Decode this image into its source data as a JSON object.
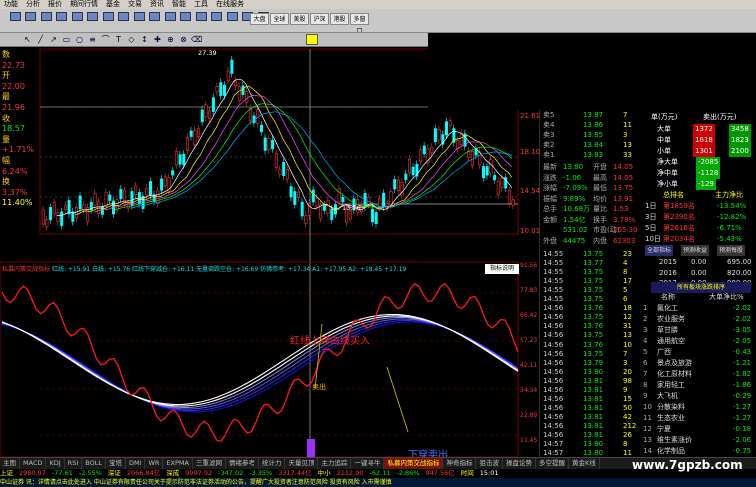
{
  "menu": [
    "功能",
    "分析",
    "报价",
    "期间行情",
    "基金",
    "交易",
    "资讯",
    "智能",
    "工具",
    "在线服务"
  ],
  "toolbar": [
    {
      "label": "退出",
      "icon": "back-icon"
    },
    {
      "label": "自选",
      "icon": "star-icon"
    },
    {
      "label": "大盘",
      "icon": "index-icon"
    },
    {
      "label": "行情",
      "icon": "quote-icon"
    },
    {
      "label": "分时",
      "icon": "minute-icon"
    },
    {
      "label": "K线",
      "icon": "kline-icon"
    },
    {
      "label": "个股",
      "icon": "stock-icon"
    },
    {
      "label": "板块",
      "icon": "sector-icon"
    },
    {
      "label": "资讯",
      "icon": "news-icon"
    },
    {
      "label": "委托",
      "icon": "trade-icon"
    },
    {
      "label": "F10",
      "icon": "f10-icon"
    },
    {
      "label": "全景",
      "icon": "view-icon"
    },
    {
      "label": "日线",
      "icon": "day-icon"
    },
    {
      "label": "周线",
      "icon": "week-icon"
    },
    {
      "label": "月线",
      "icon": "month-icon"
    },
    {
      "label": "预警",
      "icon": "alert-icon"
    },
    {
      "label": "条件",
      "icon": "filter-icon"
    }
  ],
  "toolbar_right": [
    "大盘",
    "全球",
    "美股",
    "沪深",
    "港股",
    "多窗口"
  ],
  "draw_tools": [
    "↖",
    "╱",
    "↗",
    "▭",
    "○",
    "≡",
    "⌒",
    "T",
    "◇",
    "↕",
    "✚",
    "⊕",
    "⊗",
    "⌫"
  ],
  "left_labels": [
    {
      "t": "数",
      "c": "#ffd400"
    },
    {
      "t": "22.73",
      "c": "#ff3333"
    },
    {
      "t": "开",
      "c": "#ffd400"
    },
    {
      "t": "22.00",
      "c": "#ff3333"
    },
    {
      "t": "最",
      "c": "#ffd400"
    },
    {
      "t": "21.96",
      "c": "#ff3333"
    },
    {
      "t": "收",
      "c": "#ffd400"
    },
    {
      "t": "18.57",
      "c": "#00ee00"
    },
    {
      "t": "量",
      "c": "#ffd400"
    },
    {
      "t": "+1.71%",
      "c": "#ff3333"
    },
    {
      "t": "幅",
      "c": "#ffd400"
    },
    {
      "t": "6.24%",
      "c": "#ff3333"
    },
    {
      "t": "换",
      "c": "#ffd400"
    },
    {
      "t": "3.37%",
      "c": "#ff3333"
    },
    {
      "t": "11.40%",
      "c": "#ffff00"
    }
  ],
  "main_axis": [
    "21.61",
    "18.10",
    "14.54",
    "10.01"
  ],
  "price_marks": [
    "27.39",
    "13.76",
    "14.89"
  ],
  "indicator": {
    "title": "私募内策交战指标",
    "params": "红线: +15.91  白线: +15.76  红线下穿减仓: +16.11  无量调跌空仓: +16.69  仿佛参考: +17.34  A1: +17.95  A2: +18.45  +17.19",
    "explain": "指标说明",
    "axis": [
      "91.56",
      "77.83",
      "66.42",
      "57.23",
      "42.11",
      "34.34",
      "22.89",
      "11.45"
    ],
    "ann_up": "红线上穿白线买入",
    "ann_down": "下穿卖出",
    "ann_mark": "卖出"
  },
  "quote": {
    "rows": [
      {
        "l": "卖5",
        "v": "13.87",
        "n": "7",
        "c": "#00ee00"
      },
      {
        "l": "卖4",
        "v": "13.86",
        "n": "11",
        "c": "#00ee00"
      },
      {
        "l": "卖3",
        "v": "13.85",
        "n": "3",
        "c": "#00ee00"
      },
      {
        "l": "卖2",
        "v": "13.84",
        "n": "13",
        "c": "#00ee00"
      },
      {
        "l": "卖1",
        "v": "13.83",
        "n": "33",
        "c": "#00ee00"
      }
    ],
    "stats": [
      {
        "a": "最新",
        "b": "13.80",
        "c": "开盘",
        "d": "14.05"
      },
      {
        "a": "涨跌",
        "b": "-1.06",
        "c": "最高",
        "d": "14.05"
      },
      {
        "a": "涨幅",
        "b": "-7.09%",
        "c": "最低",
        "d": "13.75"
      },
      {
        "a": "振幅",
        "b": "9.89%",
        "c": "均价",
        "d": "13.91"
      },
      {
        "a": "总手",
        "b": "10.68万",
        "c": "量比",
        "d": "1.53"
      },
      {
        "a": "金额",
        "b": "1.54亿",
        "c": "换手",
        "d": "3.78%"
      },
      {
        "a": "",
        "b": "531.02",
        "c": "市盈(动)",
        "d": "205.30"
      },
      {
        "a": "外盘",
        "b": "44475",
        "c": "内盘",
        "d": "62303"
      }
    ],
    "ticks": [
      {
        "t": "14:55",
        "p": "13.75",
        "v": "23"
      },
      {
        "t": "14:55",
        "p": "13.77",
        "v": "4"
      },
      {
        "t": "14:55",
        "p": "13.75",
        "v": "8"
      },
      {
        "t": "14:55",
        "p": "13.75",
        "v": "17"
      },
      {
        "t": "14:55",
        "p": "13.75",
        "v": "5"
      },
      {
        "t": "14:55",
        "p": "13.75",
        "v": "6"
      },
      {
        "t": "14:56",
        "p": "13.76",
        "v": "18"
      },
      {
        "t": "14:56",
        "p": "13.75",
        "v": "12"
      },
      {
        "t": "14:56",
        "p": "13.76",
        "v": "31"
      },
      {
        "t": "14:56",
        "p": "13.75",
        "v": "13"
      },
      {
        "t": "14:56",
        "p": "13.76",
        "v": "10"
      },
      {
        "t": "14:56",
        "p": "13.75",
        "v": "7"
      },
      {
        "t": "14:56",
        "p": "13.79",
        "v": "3"
      },
      {
        "t": "14:56",
        "p": "13.80",
        "v": "20"
      },
      {
        "t": "14:56",
        "p": "13.81",
        "v": "98"
      },
      {
        "t": "14:56",
        "p": "13.81",
        "v": "9"
      },
      {
        "t": "14:56",
        "p": "13.81",
        "v": "15"
      },
      {
        "t": "14:56",
        "p": "13.81",
        "v": "50"
      },
      {
        "t": "14:56",
        "p": "13.81",
        "v": "42"
      },
      {
        "t": "14:56",
        "p": "13.81",
        "v": "212"
      },
      {
        "t": "14:56",
        "p": "13.81",
        "v": "26"
      },
      {
        "t": "14:57",
        "p": "13.80",
        "v": "8"
      },
      {
        "t": "14:57",
        "p": "13.80",
        "v": "11"
      },
      {
        "t": "14:57",
        "p": "13.81",
        "v": "13"
      },
      {
        "t": "15:00",
        "p": "13.80",
        "v": "25"
      }
    ]
  },
  "right": {
    "head1": "单(万元)",
    "head2": "卖出(万元)",
    "flow": [
      {
        "l": "大单",
        "v": "1372",
        "c": "#ff3333",
        "v2": "3458"
      },
      {
        "l": "中单",
        "v": "1618",
        "c": "#ff3333",
        "v2": "1823"
      },
      {
        "l": "小单",
        "v": "1301",
        "c": "#ff3333",
        "v2": "2100"
      }
    ],
    "net": [
      {
        "l": "净大单",
        "v": "-2085"
      },
      {
        "l": "净中单",
        "v": "-1128"
      },
      {
        "l": "净小单",
        "v": "-129"
      }
    ],
    "rank_head": [
      "总排名",
      "主力净比"
    ],
    "rank": [
      {
        "d": "1日",
        "r": "第1859名",
        "p": "-13.54%"
      },
      {
        "d": "3日",
        "r": "第2390名",
        "p": "-12.82%"
      },
      {
        "d": "5日",
        "r": "第2616名",
        "p": "-6.71%"
      },
      {
        "d": "10日",
        "r": "第2034名",
        "p": "-5.43%"
      }
    ],
    "tabs": [
      "全部指标",
      "预测收益",
      "预测每股"
    ],
    "years": [
      {
        "y": "2015",
        "a": "0.00",
        "b": "695.00"
      },
      {
        "y": "2016",
        "a": "0.00",
        "b": "820.00"
      },
      {
        "y": "2017",
        "a": "0.00",
        "b": "990.00"
      }
    ],
    "sector_head": "所有板块涨跌排序",
    "sector_cols": [
      "名称",
      "大单净比%"
    ],
    "sectors": [
      {
        "n": "氟化工",
        "v": "-2.02"
      },
      {
        "n": "农业服务",
        "v": "-2.02"
      },
      {
        "n": "草甘膦",
        "v": "-3.05"
      },
      {
        "n": "通用航空",
        "v": "-2.05"
      },
      {
        "n": "广西",
        "v": "-0.43"
      },
      {
        "n": "景点及旅游",
        "v": "-1.21"
      },
      {
        "n": "化工原材料",
        "v": "-1.82"
      },
      {
        "n": "家用轻工",
        "v": "-1.86"
      },
      {
        "n": "大飞机",
        "v": "-0.29"
      },
      {
        "n": "分散染料",
        "v": "-1.27"
      },
      {
        "n": "生态农业",
        "v": "-1.27"
      },
      {
        "n": "宁夏",
        "v": "-0.18"
      },
      {
        "n": "维生素涨价",
        "v": "-2.06"
      },
      {
        "n": "化学制品",
        "v": "-0.75"
      }
    ]
  },
  "bottom_tabs": [
    "主图",
    "MACD",
    "KDJ",
    "RSI",
    "BOLL",
    "宝塔",
    "DMI",
    "WR",
    "EXPMA",
    "三重滤网",
    "情绪参考",
    "统计力",
    "天量见顶",
    "主力追踪",
    "一键寻牛",
    "私募内策交战指标",
    "神奇指标",
    "狙击波",
    "操盘论势",
    "多空提醒",
    "黄金K线"
  ],
  "status": [
    {
      "t": "上证",
      "c": "#ffff00"
    },
    {
      "t": "2980.97",
      "c": "#ff3333"
    },
    {
      "t": "-77.61",
      "c": "#00ee00"
    },
    {
      "t": "-2.55%",
      "c": "#00ee00"
    },
    {
      "t": "深证",
      "c": "#ffff00"
    },
    {
      "t": "2066.84亿",
      "c": "#ff3333"
    },
    {
      "t": "深成",
      "c": "#ffff00"
    },
    {
      "t": "9997.92",
      "c": "#ff3333"
    },
    {
      "t": "-347.02",
      "c": "#00ee00"
    },
    {
      "t": "-3.35%",
      "c": "#00ee00"
    },
    {
      "t": "3317.44亿",
      "c": "#ff3333"
    },
    {
      "t": "中小",
      "c": "#ffff00"
    },
    {
      "t": "2112.90",
      "c": "#ff3333"
    },
    {
      "t": "-62.11",
      "c": "#00ee00"
    },
    {
      "t": "-2.86%",
      "c": "#00ee00"
    },
    {
      "t": "947.56亿",
      "c": "#ff3333"
    },
    {
      "t": "时间",
      "c": "#ffff00"
    },
    {
      "t": "15:01",
      "c": "#ffffff"
    }
  ],
  "ticker": "中山证券 讯：详情请点击此处进入  中山证券有限责任公司关于提示防范非法证券活动的公告，提醒广大投资者注意防范风险  投资有风险 入市需谨慎",
  "watermark": "www.7gpzb.com",
  "colors": {
    "up": "#ff3333",
    "down": "#00ee00",
    "bg": "#000000"
  }
}
